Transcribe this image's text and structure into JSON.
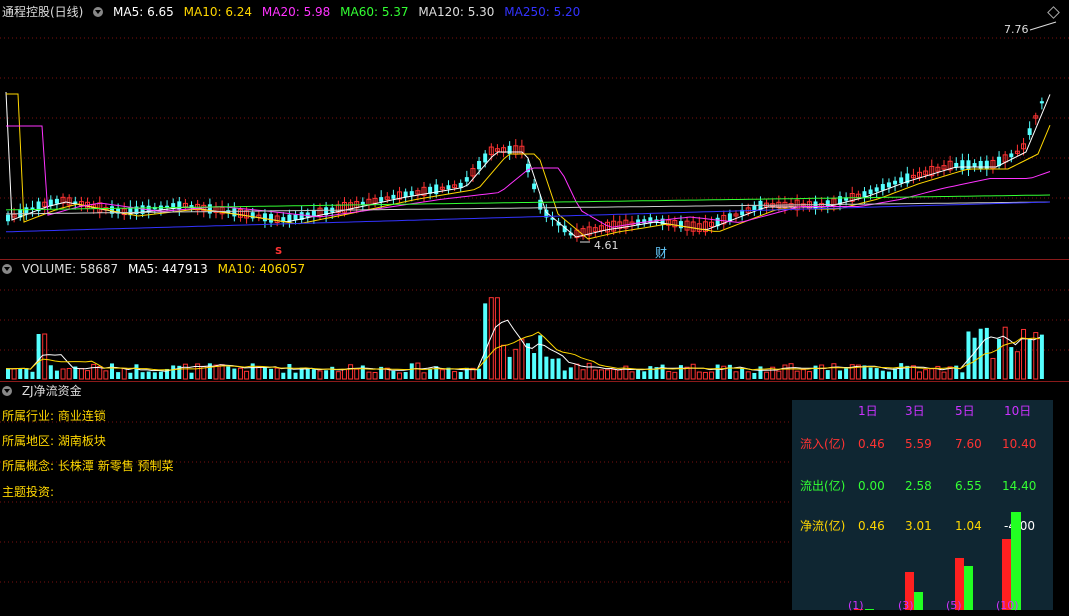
{
  "price_panel": {
    "stock_name": "通程控股(日线)",
    "ma": [
      {
        "label": "MA5: 6.65",
        "color": "#ffffff"
      },
      {
        "label": "MA10: 6.24",
        "color": "#ffd700"
      },
      {
        "label": "MA20: 5.98",
        "color": "#ff33ff"
      },
      {
        "label": "MA60: 5.37",
        "color": "#33ff33"
      },
      {
        "label": "MA120: 5.30",
        "color": "#dddddd"
      },
      {
        "label": "MA250: 5.20",
        "color": "#3333ff"
      }
    ],
    "high_label": "7.76",
    "low_label": "4.61",
    "marker_s": "S",
    "marker_cai": "财",
    "corner_icon": "diamond-icon"
  },
  "volume_panel": {
    "title": "VOLUME: 58687",
    "ma5": "MA5: 447913",
    "ma10": "MA10: 406057"
  },
  "fund_panel": {
    "title": "ZJ净流资金",
    "industry_label": "所属行业:",
    "industry_value": "商业连锁",
    "region_label": "所属地区:",
    "region_value": "湖南板块",
    "concept_label": "所属概念:",
    "concept_value": "长株潭 新零售 预制菜",
    "theme_label": "主题投资:",
    "table": {
      "headers": [
        "1日",
        "3日",
        "5日",
        "10日"
      ],
      "rows": [
        {
          "label": "流入(亿)",
          "values": [
            "0.46",
            "5.59",
            "7.60",
            "10.40"
          ],
          "color": "#ff3333"
        },
        {
          "label": "流出(亿)",
          "values": [
            "0.00",
            "2.58",
            "6.55",
            "14.40"
          ],
          "color": "#33ff33"
        },
        {
          "label": "净流(亿)",
          "values": [
            "0.46",
            "3.01",
            "1.04",
            "-4.00"
          ],
          "color": "#ffd700"
        }
      ],
      "bottom_labels": [
        "(1)",
        "(3)",
        "(5)",
        "(10)"
      ]
    }
  }
}
